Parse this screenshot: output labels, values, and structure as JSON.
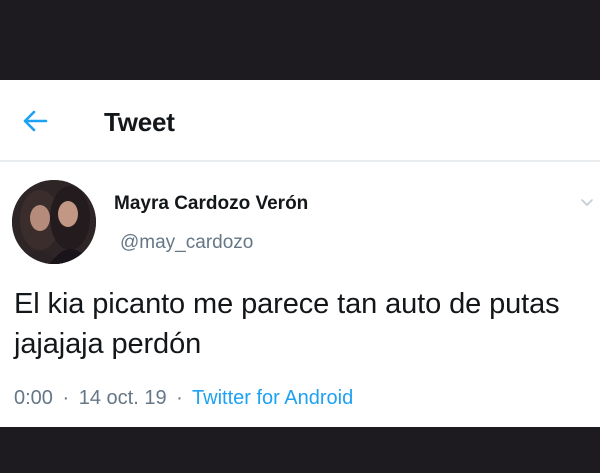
{
  "header": {
    "title": "Tweet",
    "back_icon": "arrow-left-icon"
  },
  "tweet": {
    "author_name": "Mayra Cardozo Verón",
    "author_handle": "@may_cardozo",
    "text": "El kia picanto me parece tan auto de putas jajajaja perdón",
    "time": "0:00",
    "date": "14 oct. 19",
    "separator": "·",
    "source": "Twitter for Android"
  },
  "colors": {
    "accent": "#1da1f2",
    "text_primary": "#14171a",
    "text_secondary": "#657786",
    "background": "#ffffff",
    "frame": "#1d1b20"
  }
}
